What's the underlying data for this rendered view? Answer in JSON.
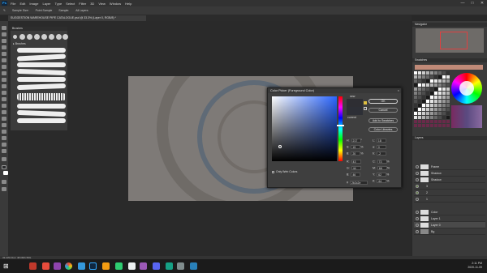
{
  "app": {
    "logo": "Ps"
  },
  "menubar": [
    "File",
    "Edit",
    "Image",
    "Layer",
    "Type",
    "Select",
    "Filter",
    "3D",
    "View",
    "Window",
    "Help"
  ],
  "window_controls": [
    "—",
    "□",
    "✕"
  ],
  "options": {
    "size_label": "Sample Size:",
    "size_value": "Point Sample",
    "sample_label": "Sample:",
    "sample_value": "All Layers"
  },
  "document_tab": "SUGGESTION WAREHOUSE PIPE CATALOGUE.psd @ 33.3% (Layer 0, RGB/8) *",
  "brushes": {
    "title": "Brushes",
    "folder": "▸ Brushes"
  },
  "panels": {
    "navigator": "Navigator",
    "swatches": "Swatches",
    "layers": "Layers"
  },
  "layers": [
    "Frame",
    "Shadow",
    "Shadow",
    "3",
    "2",
    "1",
    "Color",
    "Layer 1",
    "Layer 0",
    "Bg"
  ],
  "dialog": {
    "title": "Color Picker (Foreground Color)",
    "close": "×",
    "new_label": "new",
    "current_label": "current",
    "ok": "OK",
    "cancel": "Cancel",
    "add_swatches": "Add to Swatches",
    "color_libraries": "Color Libraries",
    "only_web": "Only Web Colors",
    "H": {
      "label": "H:",
      "value": "217",
      "unit": "°"
    },
    "S": {
      "label": "S:",
      "value": "15",
      "unit": "%"
    },
    "B": {
      "label": "B:",
      "value": "20",
      "unit": "%"
    },
    "R": {
      "label": "R:",
      "value": "43"
    },
    "G": {
      "label": "G:",
      "value": "44"
    },
    "Bl": {
      "label": "B:",
      "value": "46"
    },
    "L": {
      "label": "L:",
      "value": "18"
    },
    "a": {
      "label": "a:",
      "value": "0"
    },
    "b": {
      "label": "b:",
      "value": "-2"
    },
    "C": {
      "label": "C:",
      "value": "73",
      "unit": "%"
    },
    "M": {
      "label": "M:",
      "value": "66",
      "unit": "%"
    },
    "Y": {
      "label": "Y:",
      "value": "62",
      "unit": "%"
    },
    "K": {
      "label": "K:",
      "value": "64",
      "unit": "%"
    },
    "hex_label": "#",
    "hex": "2b2c2e"
  },
  "statusbar": "33.33%   Doc: 48.0M/1.56G",
  "taskbar": {
    "time": "2:11 PM",
    "date": "2020-11-09"
  },
  "colors": {
    "accent": "#31a8ff",
    "canvas": "#7e7a77",
    "dialog_bg": "#3f3f3f"
  }
}
